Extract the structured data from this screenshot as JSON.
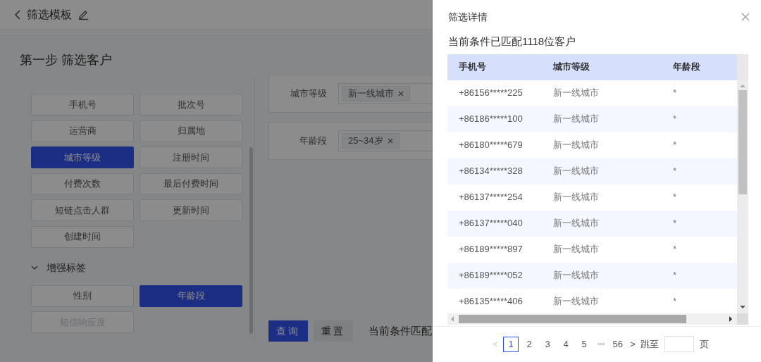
{
  "header": {
    "title": "筛选模板"
  },
  "step_title": "第一步 筛选客户",
  "tag_groups": [
    {
      "tags": [
        {
          "label": "手机号",
          "selected": false,
          "disabled": false
        },
        {
          "label": "批次号",
          "selected": false,
          "disabled": false
        },
        {
          "label": "运营商",
          "selected": false,
          "disabled": false
        },
        {
          "label": "归属地",
          "selected": false,
          "disabled": false
        },
        {
          "label": "城市等级",
          "selected": true,
          "disabled": false
        },
        {
          "label": "注册时间",
          "selected": false,
          "disabled": false
        },
        {
          "label": "付费次数",
          "selected": false,
          "disabled": false
        },
        {
          "label": "最后付费时间",
          "selected": false,
          "disabled": false
        },
        {
          "label": "短链点击人群",
          "selected": false,
          "disabled": false
        },
        {
          "label": "更新时间",
          "selected": false,
          "disabled": false
        },
        {
          "label": "创建时间",
          "selected": false,
          "disabled": false
        }
      ]
    },
    {
      "title": "增强标签",
      "expanded": true,
      "tags": [
        {
          "label": "性别",
          "selected": false,
          "disabled": false
        },
        {
          "label": "年龄段",
          "selected": true,
          "disabled": false
        },
        {
          "label": "短信响应度",
          "selected": false,
          "disabled": true
        }
      ]
    }
  ],
  "conditions": [
    {
      "label": "城市等级",
      "value": "新一线城市"
    },
    {
      "label": "年龄段",
      "value": "25~34岁"
    }
  ],
  "actions": [
    {
      "label": "查询",
      "kind": "primary"
    },
    {
      "label": "重置",
      "kind": "secondary"
    }
  ],
  "match_text": "当前条件匹配",
  "drawer": {
    "title": "筛选详情",
    "summary": "当前条件已匹配1118位客户",
    "columns": [
      "手机号",
      "城市等级",
      "年龄段"
    ],
    "rows": [
      [
        "+86156*****225",
        "新一线城市",
        "*"
      ],
      [
        "+86186*****100",
        "新一线城市",
        "*"
      ],
      [
        "+86180*****679",
        "新一线城市",
        "*"
      ],
      [
        "+86134*****328",
        "新一线城市",
        "*"
      ],
      [
        "+86137*****254",
        "新一线城市",
        "*"
      ],
      [
        "+86137*****040",
        "新一线城市",
        "*"
      ],
      [
        "+86189*****897",
        "新一线城市",
        "*"
      ],
      [
        "+86189*****052",
        "新一线城市",
        "*"
      ],
      [
        "+86135*****406",
        "新一线城市",
        "*"
      ]
    ],
    "pagination": {
      "prev": "<",
      "pages": [
        {
          "label": "1",
          "selected": true
        },
        {
          "label": "2",
          "selected": false
        },
        {
          "label": "3",
          "selected": false
        },
        {
          "label": "4",
          "selected": false
        },
        {
          "label": "5",
          "selected": false
        }
      ],
      "ellipsis": "•••",
      "last": "56",
      "next": ">",
      "jump_label": "跳至",
      "page_unit": "页"
    }
  }
}
